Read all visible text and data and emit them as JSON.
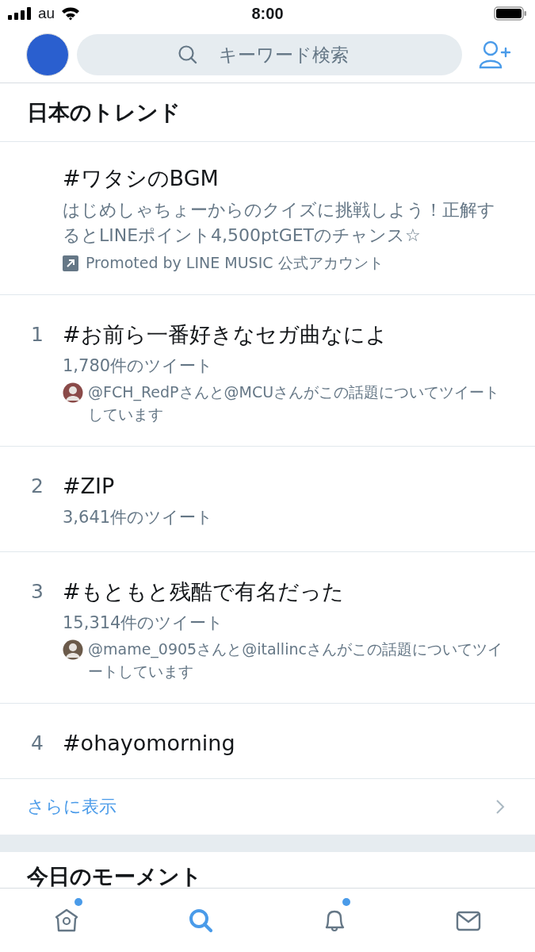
{
  "status_bar": {
    "carrier": "au",
    "time": "8:00"
  },
  "header": {
    "search": {
      "placeholder": "キーワード検索"
    }
  },
  "section_title": "日本のトレンド",
  "trends": [
    {
      "kind": "promoted",
      "name": "#ワタシのBGM",
      "description": "はじめしゃちょーからのクイズに挑戦しよう！正解するとLINEポイント4,500ptGETのチャンス☆",
      "promoted_by": "Promoted by LINE MUSIC 公式アカウント"
    },
    {
      "kind": "trend",
      "rank": "1",
      "name": "#お前ら一番好きなセガ曲なによ",
      "count": "1,780件のツイート",
      "context": "@FCH_RedPさんと@MCUさんがこの話題についてツイートしています"
    },
    {
      "kind": "trend",
      "rank": "2",
      "name": "#ZIP",
      "count": "3,641件のツイート"
    },
    {
      "kind": "trend",
      "rank": "3",
      "name": "#もともと残酷で有名だった",
      "count": "15,314件のツイート",
      "context": "@mame_0905さんと@itallincさんがこの話題についてツイートしています"
    },
    {
      "kind": "trend",
      "rank": "4",
      "name": "#ohayomorning"
    }
  ],
  "show_more": "さらに表示",
  "next_section_title": "今日のモーメント",
  "tabs": [
    {
      "kind": "home",
      "selected": false,
      "badge": true
    },
    {
      "kind": "search",
      "selected": true,
      "badge": false
    },
    {
      "kind": "notifications",
      "selected": false,
      "badge": true
    },
    {
      "kind": "messages",
      "selected": false,
      "badge": false
    }
  ]
}
